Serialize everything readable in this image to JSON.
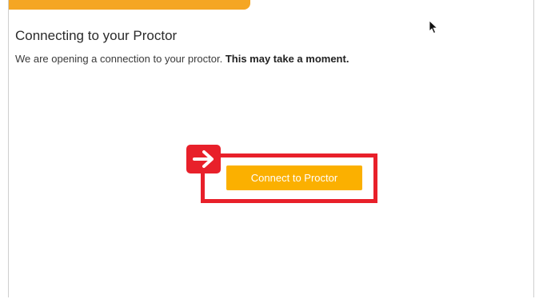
{
  "header": {
    "progress_fraction": 0.46,
    "progress_color": "#f5a623"
  },
  "main": {
    "title": "Connecting to your Proctor",
    "subtitle_prefix": "We are opening a connection to your proctor.",
    "subtitle_bold": "This may take a moment.",
    "connect_button_label": "Connect to Proctor"
  },
  "annotation": {
    "highlight_color": "#e8202a",
    "arrow_icon": "arrow-right-icon"
  },
  "colors": {
    "accent": "#fbb000"
  }
}
